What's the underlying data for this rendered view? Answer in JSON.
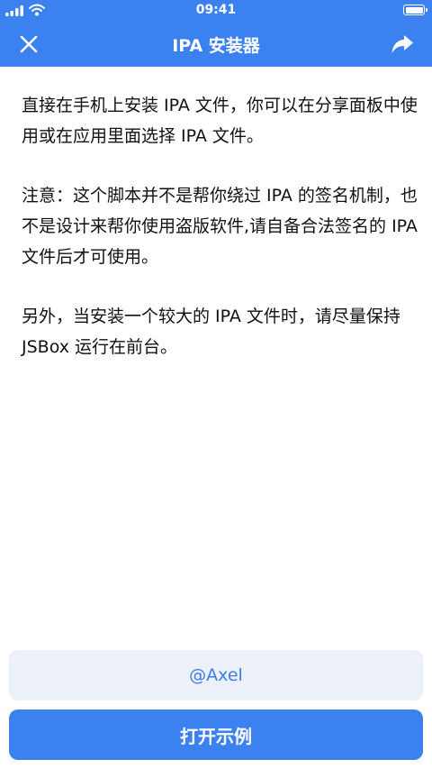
{
  "status_bar": {
    "time": "09:41"
  },
  "navbar": {
    "title": "IPA 安装器",
    "close_icon": "close-icon",
    "share_icon": "share-arrow-icon"
  },
  "content": {
    "paragraphs": [
      "直接在手机上安装 IPA 文件，你可以在分享面板中使用或在应用里面选择 IPA 文件。",
      "注意：这个脚本并不是帮你绕过 IPA 的签名机制，也不是设计来帮你使用盗版软件,请自备合法签名的 IPA 文件后才可使用。",
      "另外，当安装一个较大的 IPA 文件时，请尽量保持 JSBox 运行在前台。"
    ]
  },
  "author": {
    "label": "@Axel"
  },
  "open_button": {
    "label": "打开示例"
  },
  "colors": {
    "accent": "#3b82f0",
    "author_bg": "#ecf1f9",
    "author_text": "#3b7de8"
  }
}
